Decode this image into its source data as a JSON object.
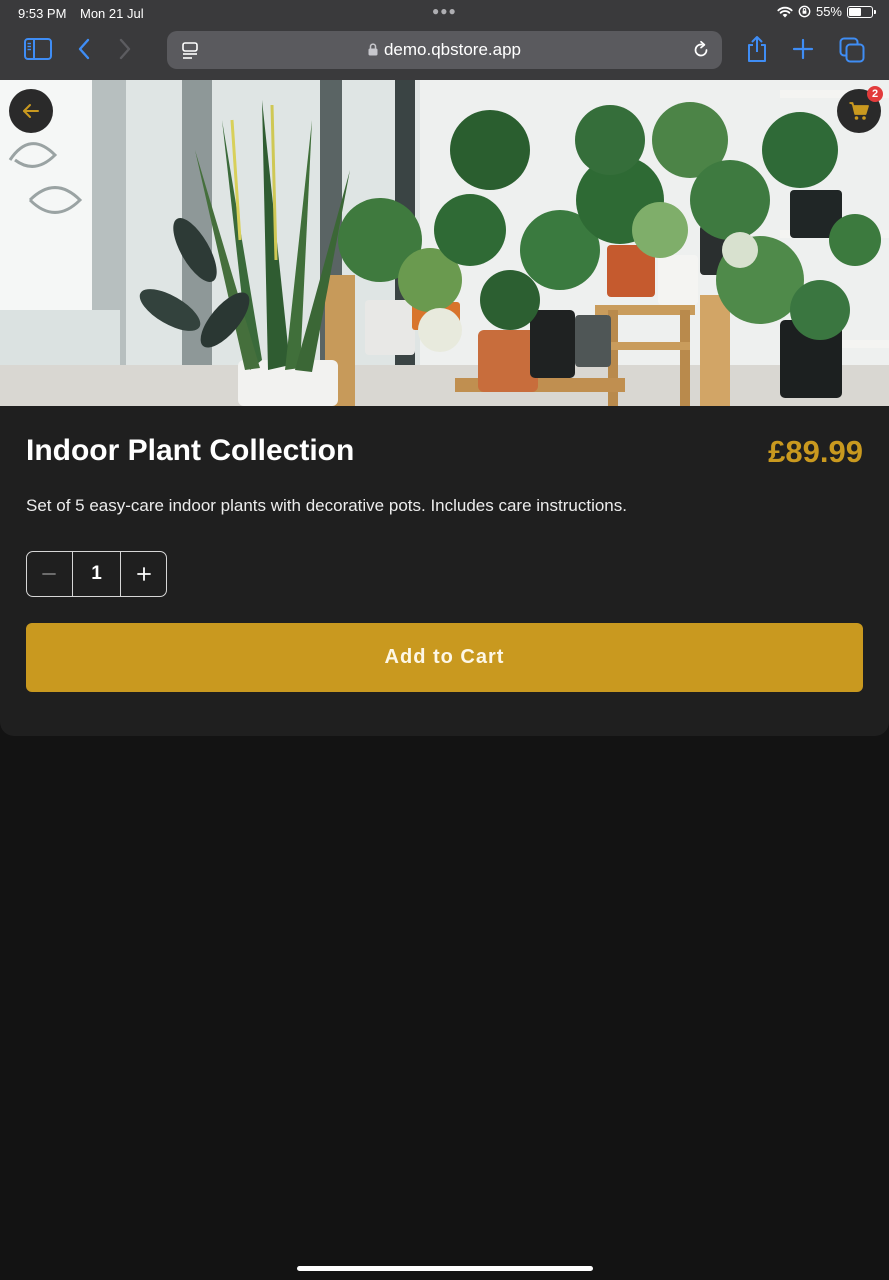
{
  "status_bar": {
    "time": "9:53 PM",
    "date": "Mon 21 Jul",
    "battery": "55%",
    "battery_level": 0.55
  },
  "browser": {
    "url": "demo.qbstore.app",
    "icons": [
      "sidebar-icon",
      "back-icon",
      "forward-icon",
      "reader-icon",
      "lock-icon",
      "reload-icon",
      "share-icon",
      "new-tab-icon",
      "tabs-icon"
    ]
  },
  "hero": {
    "image_subject": "indoor plants",
    "back_icon": "arrow-left-icon",
    "cart_icon": "shopping-cart-icon",
    "cart_count": "2"
  },
  "product": {
    "title": "Indoor Plant Collection",
    "price": "£89.99",
    "description": "Set of 5 easy-care indoor plants with decorative pots. Includes care instructions.",
    "quantity": "1",
    "add_to_cart_label": "Add to Cart"
  },
  "colors": {
    "accent": "#c9991f",
    "card_background": "#1f1f1f",
    "page_background": "#131313",
    "badge": "#e23b3b",
    "browser_tint": "#3f8df5"
  }
}
